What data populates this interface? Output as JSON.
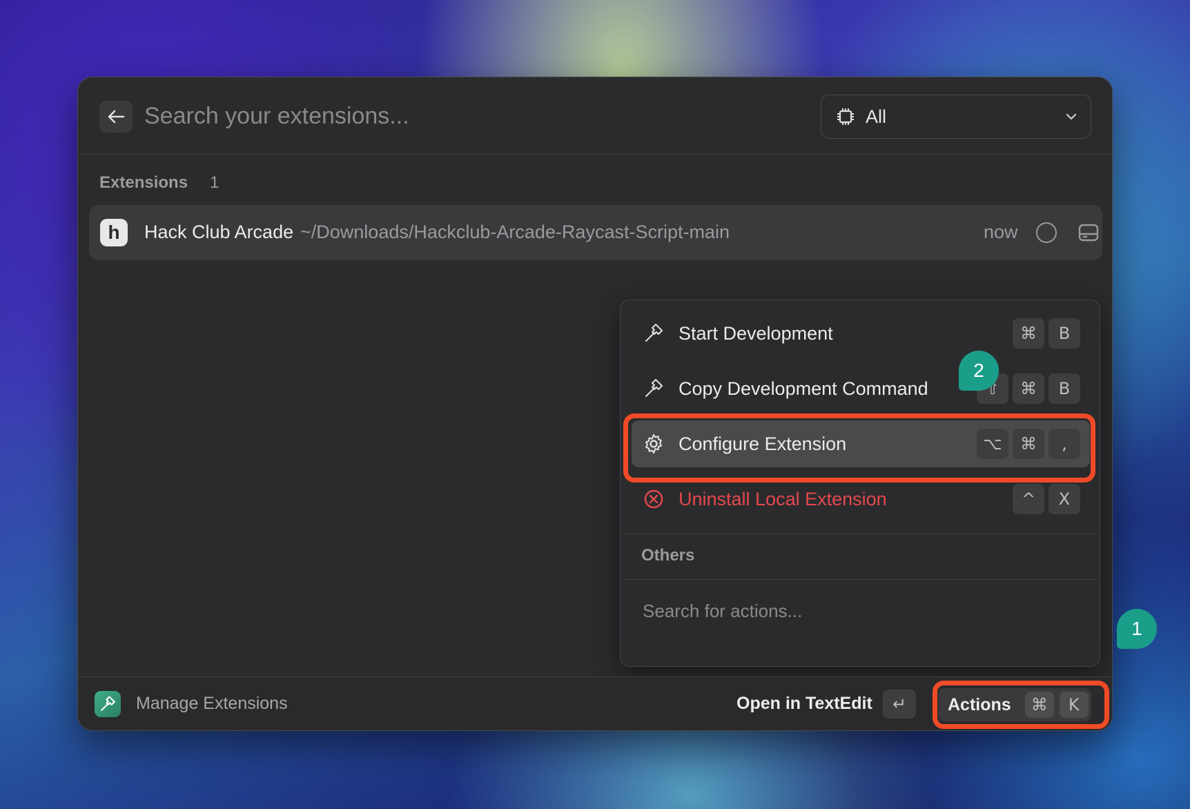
{
  "search": {
    "placeholder": "Search your extensions..."
  },
  "filter": {
    "value": "All"
  },
  "list": {
    "section_title": "Extensions",
    "section_count": "1",
    "items": [
      {
        "icon_letter": "h",
        "title": "Hack Club Arcade",
        "path": "~/Downloads/Hackclub-Arcade-Raycast-Script-main",
        "time": "now"
      }
    ]
  },
  "menu": {
    "items": [
      {
        "label": "Start Development",
        "keys": [
          "⌘",
          "B"
        ],
        "icon": "hammer-icon"
      },
      {
        "label": "Copy Development Command",
        "keys": [
          "⇧",
          "⌘",
          "B"
        ],
        "icon": "hammer-icon"
      },
      {
        "label": "Configure Extension",
        "keys": [
          "⌥",
          "⌘",
          ","
        ],
        "icon": "gear-icon"
      },
      {
        "label": "Uninstall Local Extension",
        "keys": [
          "^",
          "X"
        ],
        "icon": "x-circle-icon"
      }
    ],
    "section": "Others",
    "search_placeholder": "Search for actions..."
  },
  "footer": {
    "title": "Manage Extensions",
    "primary_action": "Open in TextEdit",
    "enter_key": "↵",
    "actions_label": "Actions",
    "actions_keys": [
      "⌘",
      "K"
    ]
  },
  "annotations": {
    "badge1": "1",
    "badge2": "2"
  },
  "colors": {
    "highlight": "#f04a26",
    "badge": "#1a9e8a",
    "danger": "#e5484d"
  }
}
